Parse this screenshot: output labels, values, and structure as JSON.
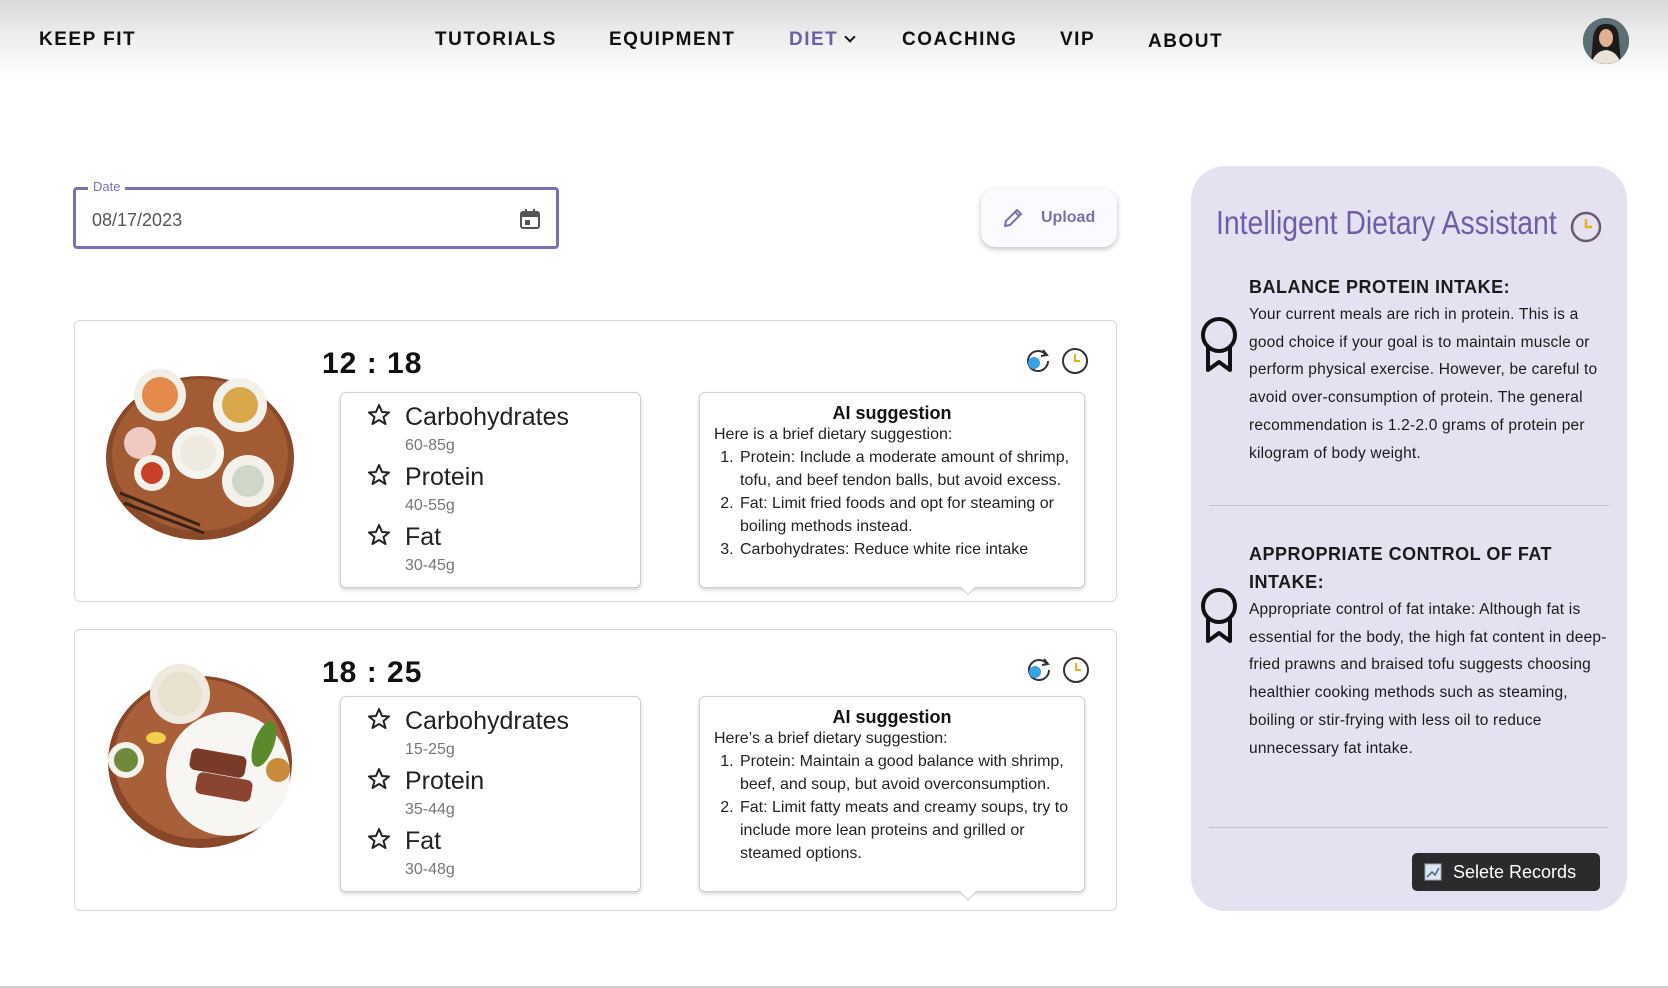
{
  "nav": {
    "brand": "KEEP FIT",
    "items": [
      {
        "label": "TUTORIALS",
        "active": false
      },
      {
        "label": "EQUIPMENT",
        "active": false
      },
      {
        "label": "DIET",
        "active": true
      },
      {
        "label": "COACHING",
        "active": false
      },
      {
        "label": "VIP",
        "active": false
      },
      {
        "label": "ABOUT",
        "active": false
      }
    ]
  },
  "date_field": {
    "label": "Date",
    "value": "08/17/2023"
  },
  "upload": {
    "label": "Upload"
  },
  "meals": [
    {
      "time": "12 : 18",
      "nutrients": [
        {
          "name": "Carbohydrates",
          "range": "60-85g"
        },
        {
          "name": "Protein",
          "range": "40-55g"
        },
        {
          "name": "Fat",
          "range": "30-45g"
        }
      ],
      "ai": {
        "title": "AI suggestion",
        "intro": "Here is a brief dietary suggestion:",
        "items": [
          "Protein: Include a moderate amount of shrimp, tofu, and beef tendon balls, but avoid excess.",
          "Fat: Limit fried foods and opt for steaming or boiling methods instead.",
          "Carbohydrates: Reduce white rice intake"
        ]
      }
    },
    {
      "time": "18 : 25",
      "nutrients": [
        {
          "name": "Carbohydrates",
          "range": "15-25g"
        },
        {
          "name": "Protein",
          "range": "35-44g"
        },
        {
          "name": "Fat",
          "range": "30-48g"
        }
      ],
      "ai": {
        "title": "AI suggestion",
        "intro": "Here’s a brief dietary suggestion:",
        "items": [
          "Protein: Maintain a good balance with shrimp, beef, and soup, but avoid overconsumption.",
          "Fat: Limit fatty meats and creamy soups, try to include more lean proteins and grilled or steamed options."
        ]
      }
    }
  ],
  "assistant": {
    "title": "Intelligent Dietary Assistant",
    "tips": [
      {
        "heading": "BALANCE PROTEIN INTAKE:",
        "body": "Your current meals are rich in protein. This is a good choice if your goal is to maintain muscle or perform physical exercise. However, be careful to avoid over-consumption of protein. The general recommendation is 1.2-2.0 grams of protein per kilogram of body weight."
      },
      {
        "heading": "APPROPRIATE CONTROL OF FAT INTAKE:",
        "body": "Appropriate control of fat intake: Although fat is essential for the body, the high fat content in deep-fried prawns and braised tofu suggests choosing healthier cooking methods such as steaming, boiling or stir-frying with less oil to reduce unnecessary fat intake."
      }
    ],
    "records_button": "Selete Records"
  },
  "colors": {
    "accent": "#7a6fb0",
    "panel": "#e6e1f1",
    "clock": "#e8b21a"
  }
}
